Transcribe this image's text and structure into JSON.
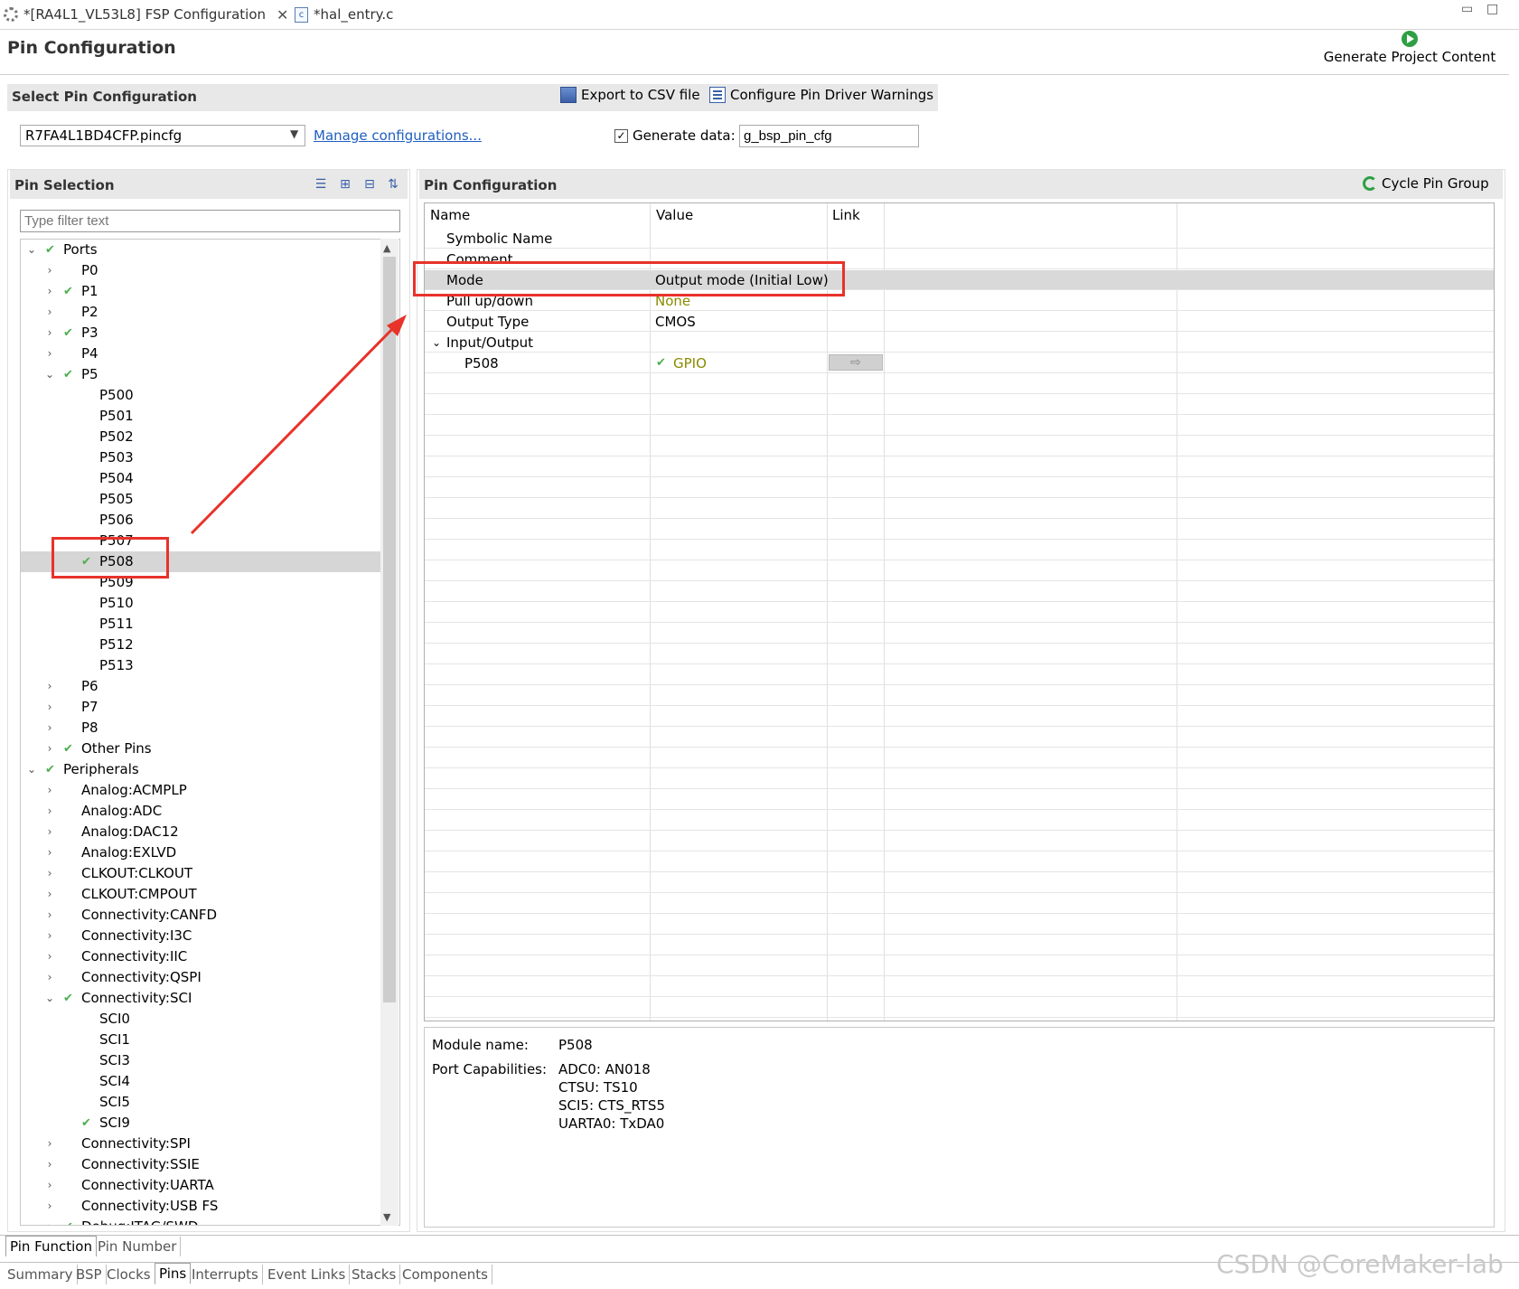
{
  "editor_tabs": [
    {
      "label": "*[RA4L1_VL53L8] FSP Configuration"
    },
    {
      "label": "*hal_entry.c"
    }
  ],
  "header": {
    "title": "Pin Configuration",
    "generate_label": "Generate Project Content"
  },
  "select_pin_config": {
    "title": "Select Pin Configuration",
    "export_label": "Export to CSV file",
    "warnings_label": "Configure Pin Driver Warnings",
    "config_file": "R7FA4L1BD4CFP.pincfg",
    "manage_link": "Manage configurations...",
    "generate_data_label": "Generate data:",
    "generate_data_checked": true,
    "generate_data_value": "g_bsp_pin_cfg"
  },
  "pin_selection": {
    "title": "Pin Selection",
    "filter_placeholder": "Type filter text",
    "tree": [
      {
        "label": "Ports",
        "level": 0,
        "expand": "open",
        "check": true
      },
      {
        "label": "P0",
        "level": 1,
        "expand": "closed",
        "check": false
      },
      {
        "label": "P1",
        "level": 1,
        "expand": "closed",
        "check": true
      },
      {
        "label": "P2",
        "level": 1,
        "expand": "closed",
        "check": false
      },
      {
        "label": "P3",
        "level": 1,
        "expand": "closed",
        "check": true
      },
      {
        "label": "P4",
        "level": 1,
        "expand": "closed",
        "check": false
      },
      {
        "label": "P5",
        "level": 1,
        "expand": "open",
        "check": true
      },
      {
        "label": "P500",
        "level": 2,
        "expand": "none",
        "check": false
      },
      {
        "label": "P501",
        "level": 2,
        "expand": "none",
        "check": false
      },
      {
        "label": "P502",
        "level": 2,
        "expand": "none",
        "check": false
      },
      {
        "label": "P503",
        "level": 2,
        "expand": "none",
        "check": false
      },
      {
        "label": "P504",
        "level": 2,
        "expand": "none",
        "check": false
      },
      {
        "label": "P505",
        "level": 2,
        "expand": "none",
        "check": false
      },
      {
        "label": "P506",
        "level": 2,
        "expand": "none",
        "check": false
      },
      {
        "label": "P507",
        "level": 2,
        "expand": "none",
        "check": false
      },
      {
        "label": "P508",
        "level": 2,
        "expand": "none",
        "check": true,
        "selected": true
      },
      {
        "label": "P509",
        "level": 2,
        "expand": "none",
        "check": false
      },
      {
        "label": "P510",
        "level": 2,
        "expand": "none",
        "check": false
      },
      {
        "label": "P511",
        "level": 2,
        "expand": "none",
        "check": false
      },
      {
        "label": "P512",
        "level": 2,
        "expand": "none",
        "check": false
      },
      {
        "label": "P513",
        "level": 2,
        "expand": "none",
        "check": false
      },
      {
        "label": "P6",
        "level": 1,
        "expand": "closed",
        "check": false
      },
      {
        "label": "P7",
        "level": 1,
        "expand": "closed",
        "check": false
      },
      {
        "label": "P8",
        "level": 1,
        "expand": "closed",
        "check": false
      },
      {
        "label": "Other Pins",
        "level": 1,
        "expand": "closed",
        "check": true
      },
      {
        "label": "Peripherals",
        "level": 0,
        "expand": "open",
        "check": true
      },
      {
        "label": "Analog:ACMPLP",
        "level": 1,
        "expand": "closed",
        "check": false
      },
      {
        "label": "Analog:ADC",
        "level": 1,
        "expand": "closed",
        "check": false
      },
      {
        "label": "Analog:DAC12",
        "level": 1,
        "expand": "closed",
        "check": false
      },
      {
        "label": "Analog:EXLVD",
        "level": 1,
        "expand": "closed",
        "check": false
      },
      {
        "label": "CLKOUT:CLKOUT",
        "level": 1,
        "expand": "closed",
        "check": false
      },
      {
        "label": "CLKOUT:CMPOUT",
        "level": 1,
        "expand": "closed",
        "check": false
      },
      {
        "label": "Connectivity:CANFD",
        "level": 1,
        "expand": "closed",
        "check": false
      },
      {
        "label": "Connectivity:I3C",
        "level": 1,
        "expand": "closed",
        "check": false
      },
      {
        "label": "Connectivity:IIC",
        "level": 1,
        "expand": "closed",
        "check": false
      },
      {
        "label": "Connectivity:QSPI",
        "level": 1,
        "expand": "closed",
        "check": false
      },
      {
        "label": "Connectivity:SCI",
        "level": 1,
        "expand": "open",
        "check": true
      },
      {
        "label": "SCI0",
        "level": 2,
        "expand": "none",
        "check": false
      },
      {
        "label": "SCI1",
        "level": 2,
        "expand": "none",
        "check": false
      },
      {
        "label": "SCI3",
        "level": 2,
        "expand": "none",
        "check": false
      },
      {
        "label": "SCI4",
        "level": 2,
        "expand": "none",
        "check": false
      },
      {
        "label": "SCI5",
        "level": 2,
        "expand": "none",
        "check": false
      },
      {
        "label": "SCI9",
        "level": 2,
        "expand": "none",
        "check": true
      },
      {
        "label": "Connectivity:SPI",
        "level": 1,
        "expand": "closed",
        "check": false
      },
      {
        "label": "Connectivity:SSIE",
        "level": 1,
        "expand": "closed",
        "check": false
      },
      {
        "label": "Connectivity:UARTA",
        "level": 1,
        "expand": "closed",
        "check": false
      },
      {
        "label": "Connectivity:USB FS",
        "level": 1,
        "expand": "closed",
        "check": false
      },
      {
        "label": "Debug:JTAG/SWD",
        "level": 1,
        "expand": "closed",
        "check": true
      }
    ]
  },
  "pin_config": {
    "title": "Pin Configuration",
    "cycle_label": "Cycle Pin Group",
    "columns": [
      "Name",
      "Value",
      "Link"
    ],
    "rows": [
      {
        "name": "Symbolic Name",
        "value": "",
        "indent": 1,
        "selected": false
      },
      {
        "name": "Comment",
        "value": "",
        "indent": 1,
        "selected": false
      },
      {
        "name": "Mode",
        "value": "Output mode (Initial Low)",
        "indent": 1,
        "selected": true
      },
      {
        "name": "Pull up/down",
        "value": "None",
        "indent": 1,
        "value_color": "#8a8a00",
        "selected": false
      },
      {
        "name": "Output Type",
        "value": "CMOS",
        "indent": 1,
        "selected": false
      },
      {
        "name": "Input/Output",
        "value": "",
        "indent": 1,
        "expand": "open",
        "selected": false
      },
      {
        "name": "P508",
        "value": "GPIO",
        "indent": 2,
        "value_color": "#8a8a00",
        "value_check": true,
        "link": true,
        "selected": false
      }
    ],
    "detail": {
      "module_label": "Module name:",
      "module_value": "P508",
      "caps_label": "Port Capabilities:",
      "caps": [
        "ADC0: AN018",
        "CTSU: TS10",
        "SCI5: CTS_RTS5",
        "UARTA0: TxDA0"
      ]
    }
  },
  "pin_tabs": [
    "Pin Function",
    "Pin Number"
  ],
  "page_tabs": [
    "Summary",
    "BSP",
    "Clocks",
    "Pins",
    "Interrupts",
    "Event Links",
    "Stacks",
    "Components"
  ],
  "active_page_tab": "Pins",
  "watermark": "CSDN @CoreMaker-lab",
  "colors": {
    "annotation_red": "#e8322a",
    "check_green": "#4caf50"
  }
}
